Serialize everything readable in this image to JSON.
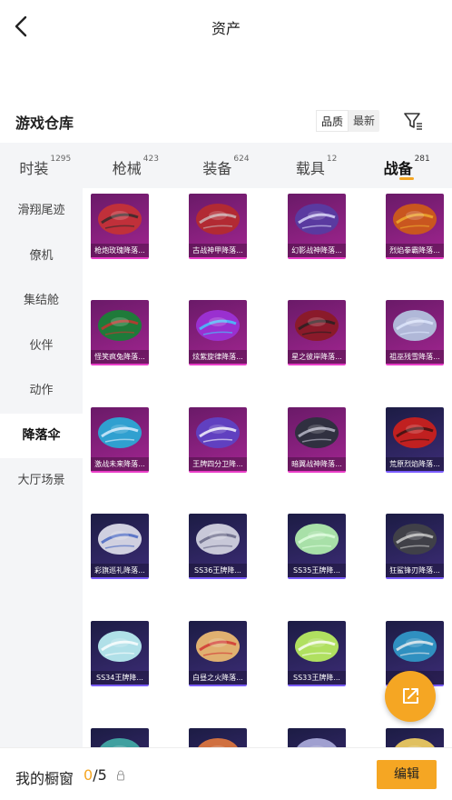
{
  "header": {
    "title": "资产"
  },
  "warehouse": {
    "title": "游戏仓库",
    "sort_options": [
      "品质",
      "最新"
    ]
  },
  "tabs": [
    {
      "label": "时装",
      "count": "1295"
    },
    {
      "label": "枪械",
      "count": "423"
    },
    {
      "label": "装备",
      "count": "624"
    },
    {
      "label": "载具",
      "count": "12"
    },
    {
      "label": "战备",
      "count": "281"
    }
  ],
  "active_tab": 4,
  "sidebar": [
    "滑翔尾迹",
    "僚机",
    "集结舱",
    "伙伴",
    "动作",
    "降落伞",
    "大厅场景"
  ],
  "active_sidebar": 5,
  "items": [
    {
      "name": "枪炮玫瑰降落...",
      "rarity": "pink",
      "canopy": "#c0303a",
      "accent": "#2a2a2a"
    },
    {
      "name": "古战神甲降落...",
      "rarity": "pink",
      "canopy": "#b22a33",
      "accent": "#ccbbbb"
    },
    {
      "name": "幻影战神降落...",
      "rarity": "pink",
      "canopy": "#5a3aa0",
      "accent": "#e0e0ff"
    },
    {
      "name": "烈焰拳霸降落...",
      "rarity": "pink",
      "canopy": "#c9561f",
      "accent": "#f0b030"
    },
    {
      "name": "怪笑疯兔降落...",
      "rarity": "pink",
      "canopy": "#1f7a3a",
      "accent": "#d03030"
    },
    {
      "name": "炫紫旋律降落...",
      "rarity": "pink",
      "canopy": "#9a30d0",
      "accent": "#40d0ff"
    },
    {
      "name": "星之彼岸降落...",
      "rarity": "pink",
      "canopy": "#8a1a2a",
      "accent": "#202020"
    },
    {
      "name": "祖巫残雪降落...",
      "rarity": "pink",
      "canopy": "#b0b8d8",
      "accent": "#e0e8ff"
    },
    {
      "name": "激战未来降落...",
      "rarity": "pink",
      "canopy": "#30a0d0",
      "accent": "#e0f0ff"
    },
    {
      "name": "王牌四分卫降...",
      "rarity": "pink",
      "canopy": "#6040c0",
      "accent": "#ffffff"
    },
    {
      "name": "暗翼战神降落...",
      "rarity": "pink",
      "canopy": "#303040",
      "accent": "#c0c0d0"
    },
    {
      "name": "荒原烈焰降落...",
      "rarity": "blue",
      "canopy": "#c02020",
      "accent": "#301010"
    },
    {
      "name": "彩旗巡礼降落...",
      "rarity": "blue",
      "canopy": "#d0d0e0",
      "accent": "#4060c0"
    },
    {
      "name": "SS36王牌降...",
      "rarity": "blue",
      "canopy": "#c8c8d8",
      "accent": "#606080"
    },
    {
      "name": "SS35王牌降...",
      "rarity": "blue",
      "canopy": "#a8e0a8",
      "accent": "#e0ffe0"
    },
    {
      "name": "狂鲨锋刃降落...",
      "rarity": "blue",
      "canopy": "#404048",
      "accent": "#d0d0d0"
    },
    {
      "name": "SS34王牌降...",
      "rarity": "blue",
      "canopy": "#b0e0e8",
      "accent": "#ffffff"
    },
    {
      "name": "白昼之火降落...",
      "rarity": "blue",
      "canopy": "#e0b070",
      "accent": "#d03030"
    },
    {
      "name": "SS33王牌降...",
      "rarity": "blue",
      "canopy": "#b0e060",
      "accent": "#ffffff"
    },
    {
      "name": "",
      "rarity": "blue",
      "canopy": "#3090c0",
      "accent": "#f0f0f0"
    },
    {
      "name": "",
      "rarity": "blue",
      "canopy": "#40a0a0",
      "accent": "#ffffff"
    },
    {
      "name": "",
      "rarity": "blue",
      "canopy": "#d07040",
      "accent": "#ffffff"
    },
    {
      "name": "",
      "rarity": "blue",
      "canopy": "#a0a0d0",
      "accent": "#ffffff"
    },
    {
      "name": "",
      "rarity": "blue",
      "canopy": "#e0c060",
      "accent": "#ffffff"
    }
  ],
  "showcase": {
    "label": "我的橱窗",
    "current": "0",
    "total": "/5"
  },
  "edit_label": "编辑",
  "colors": {
    "accent": "#f5a623",
    "pink_rarity": "#e83cc6",
    "blue_rarity": "#7a5cff"
  }
}
